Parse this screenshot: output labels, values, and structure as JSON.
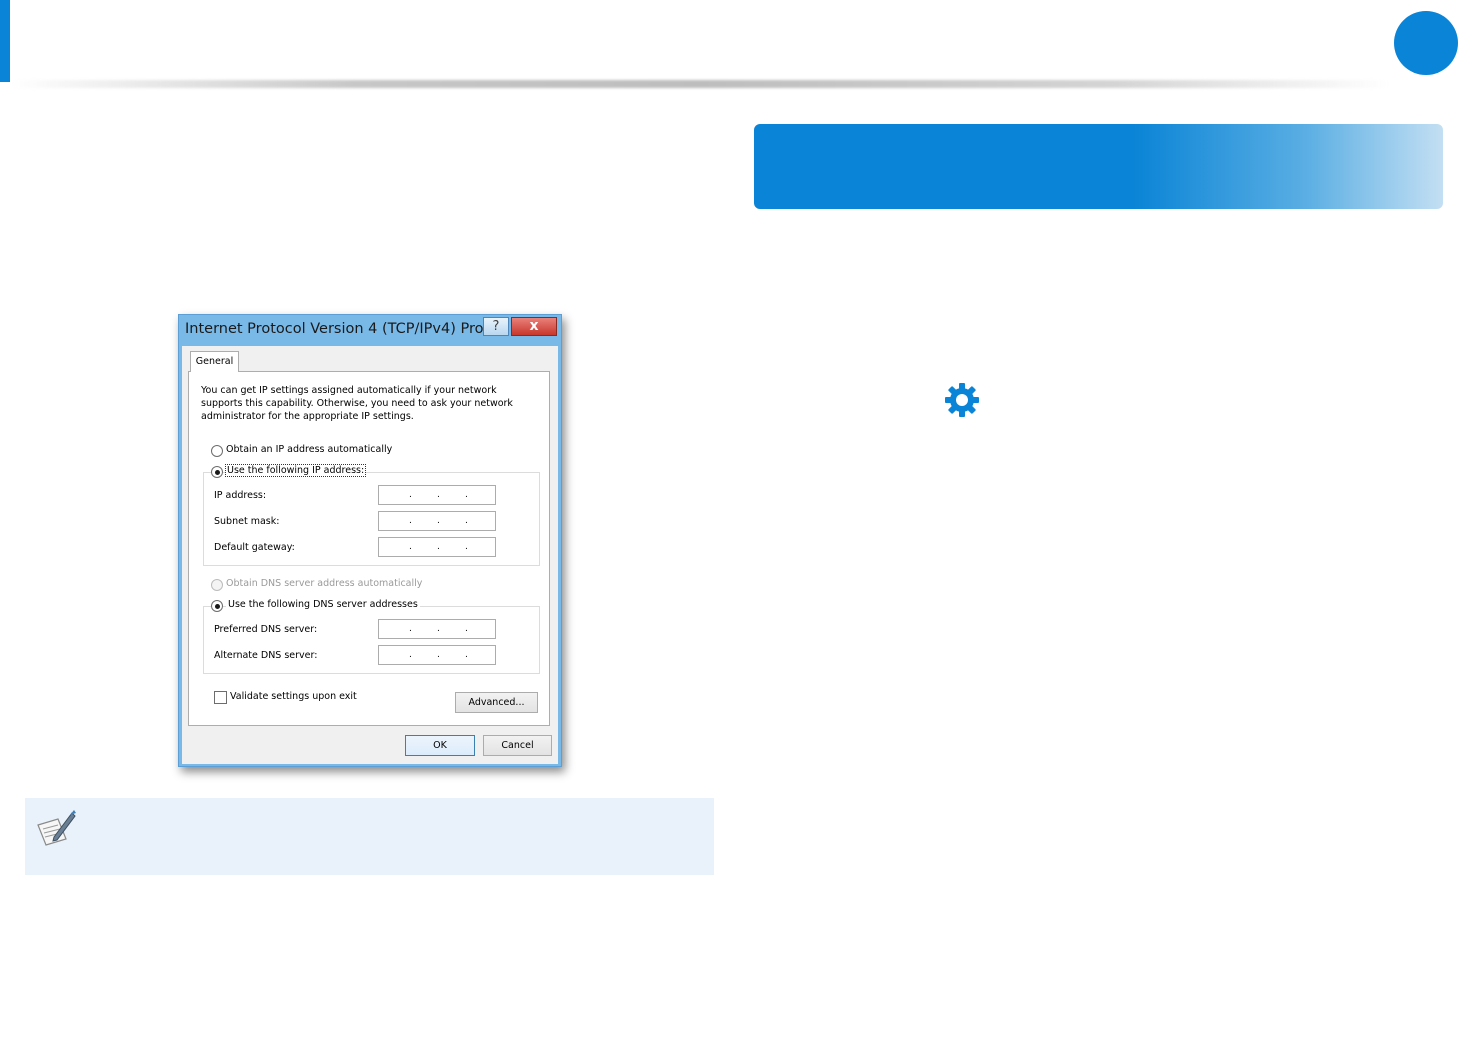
{
  "colors": {
    "accent": "#0a84d6",
    "note_bg": "#e9f2fa",
    "close_button": "#c7372c"
  },
  "dialog": {
    "title": "Internet Protocol Version 4 (TCP/IPv4) Pro...",
    "help_glyph": "?",
    "close_glyph": "x",
    "tab_label": "General",
    "description": "You can get IP settings assigned automatically if your network supports this capability. Otherwise, you need to ask your network administrator for the appropriate IP settings.",
    "ip_section": {
      "auto_label": "Obtain an IP address automatically",
      "manual_label": "Use the following IP address:",
      "selected": "manual",
      "fields": [
        {
          "label": "IP address:",
          "value": ". . ."
        },
        {
          "label": "Subnet mask:",
          "value": ". . ."
        },
        {
          "label": "Default gateway:",
          "value": ". . ."
        }
      ]
    },
    "dns_section": {
      "auto_label": "Obtain DNS server address automatically",
      "manual_label": "Use the following DNS server addresses",
      "selected": "manual",
      "fields": [
        {
          "label": "Preferred DNS server:",
          "value": ". . ."
        },
        {
          "label": "Alternate DNS server:",
          "value": ". . ."
        }
      ]
    },
    "validate_label": "Validate settings upon exit",
    "validate_checked": false,
    "advanced_label": "Advanced...",
    "ok_label": "OK",
    "cancel_label": "Cancel"
  },
  "icons": {
    "gear": "gear-icon",
    "note": "note-pen-icon"
  }
}
